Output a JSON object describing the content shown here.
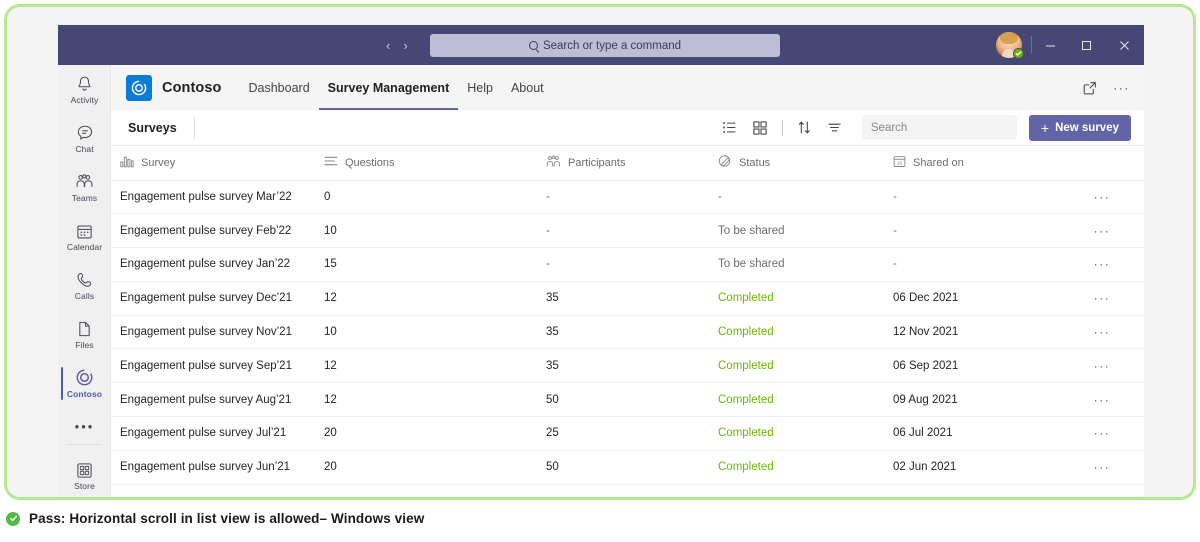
{
  "titlebar": {
    "back_label": "‹",
    "forward_label": "›",
    "command_placeholder": "Search or type a command",
    "minimize_label": "─",
    "maximize_label": "□",
    "close_label": "✕"
  },
  "rail": {
    "items": [
      {
        "label": "Activity",
        "icon": "bell-icon",
        "active": false
      },
      {
        "label": "Chat",
        "icon": "chat-bubble-icon",
        "active": false
      },
      {
        "label": "Teams",
        "icon": "teams-people-icon",
        "active": false
      },
      {
        "label": "Calendar",
        "icon": "calendar-icon",
        "active": false
      },
      {
        "label": "Calls",
        "icon": "phone-icon",
        "active": false
      },
      {
        "label": "Files",
        "icon": "file-icon",
        "active": false
      },
      {
        "label": "Contoso",
        "icon": "contoso-swirl-icon",
        "active": true
      },
      {
        "label": "Store",
        "icon": "store-grid-icon",
        "active": false
      }
    ],
    "more_label": "•••"
  },
  "app": {
    "brand": "Contoso",
    "logo_color": "#0a7cd5",
    "nav": [
      {
        "label": "Dashboard",
        "active": false
      },
      {
        "label": "Survey Management",
        "active": true
      },
      {
        "label": "Help",
        "active": false
      },
      {
        "label": "About",
        "active": false
      }
    ],
    "header_icons": [
      {
        "name": "pop-out-icon"
      },
      {
        "name": "more-options-icon",
        "label": "···"
      }
    ]
  },
  "panel": {
    "title": "Surveys",
    "tools": [
      {
        "name": "list-view-icon",
        "active": true
      },
      {
        "name": "grid-view-icon",
        "active": false
      },
      {
        "name": "sort-icon",
        "active": false
      },
      {
        "name": "filter-icon",
        "active": false
      }
    ],
    "search_placeholder": "Search",
    "search_value": "",
    "new_button": {
      "plus": "+",
      "label": "New survey",
      "color": "#6264a7"
    }
  },
  "table": {
    "columns": [
      {
        "key": "survey",
        "label": "Survey",
        "icon": "bar-chart-icon"
      },
      {
        "key": "questions",
        "label": "Questions",
        "icon": "lines-icon"
      },
      {
        "key": "participants",
        "label": "Participants",
        "icon": "people-icon"
      },
      {
        "key": "status",
        "label": "Status",
        "icon": "pencil-icon"
      },
      {
        "key": "shared_on",
        "label": "Shared on",
        "icon": "calendar-18-icon"
      }
    ],
    "row_action_label": "···",
    "rows": [
      {
        "survey": "Engagement pulse survey Mar’22",
        "questions": "0",
        "participants": "-",
        "status": "-",
        "status_kind": "muted",
        "shared_on": "-"
      },
      {
        "survey": "Engagement pulse survey Feb’22",
        "questions": "10",
        "participants": "-",
        "status": "To be shared",
        "status_kind": "muted",
        "shared_on": "-"
      },
      {
        "survey": "Engagement pulse survey Jan’22",
        "questions": "15",
        "participants": "-",
        "status": "To be shared",
        "status_kind": "muted",
        "shared_on": "-"
      },
      {
        "survey": "Engagement pulse survey Dec’21",
        "questions": "12",
        "participants": "35",
        "status": "Completed",
        "status_kind": "completed",
        "shared_on": "06 Dec 2021"
      },
      {
        "survey": "Engagement pulse survey Nov’21",
        "questions": "10",
        "participants": "35",
        "status": "Completed",
        "status_kind": "completed",
        "shared_on": "12 Nov 2021"
      },
      {
        "survey": "Engagement pulse survey Sep’21",
        "questions": "12",
        "participants": "35",
        "status": "Completed",
        "status_kind": "completed",
        "shared_on": "06 Sep 2021"
      },
      {
        "survey": "Engagement pulse survey Aug’21",
        "questions": "12",
        "participants": "50",
        "status": "Completed",
        "status_kind": "completed",
        "shared_on": "09 Aug 2021"
      },
      {
        "survey": "Engagement pulse survey Jul’21",
        "questions": "20",
        "participants": "25",
        "status": "Completed",
        "status_kind": "completed",
        "shared_on": "06 Jul 2021"
      },
      {
        "survey": "Engagement pulse survey Jun’21",
        "questions": "20",
        "participants": "50",
        "status": "Completed",
        "status_kind": "completed",
        "shared_on": "02 Jun 2021"
      }
    ]
  },
  "caption": {
    "text": "Pass: Horizontal scroll in list view is allowed– Windows view",
    "check_color": "#54b948"
  },
  "theme": {
    "titlebar_color": "#464775",
    "accent_color": "#6264a7",
    "status_green": "#6bb700",
    "frame_green": "#b5e88f"
  }
}
